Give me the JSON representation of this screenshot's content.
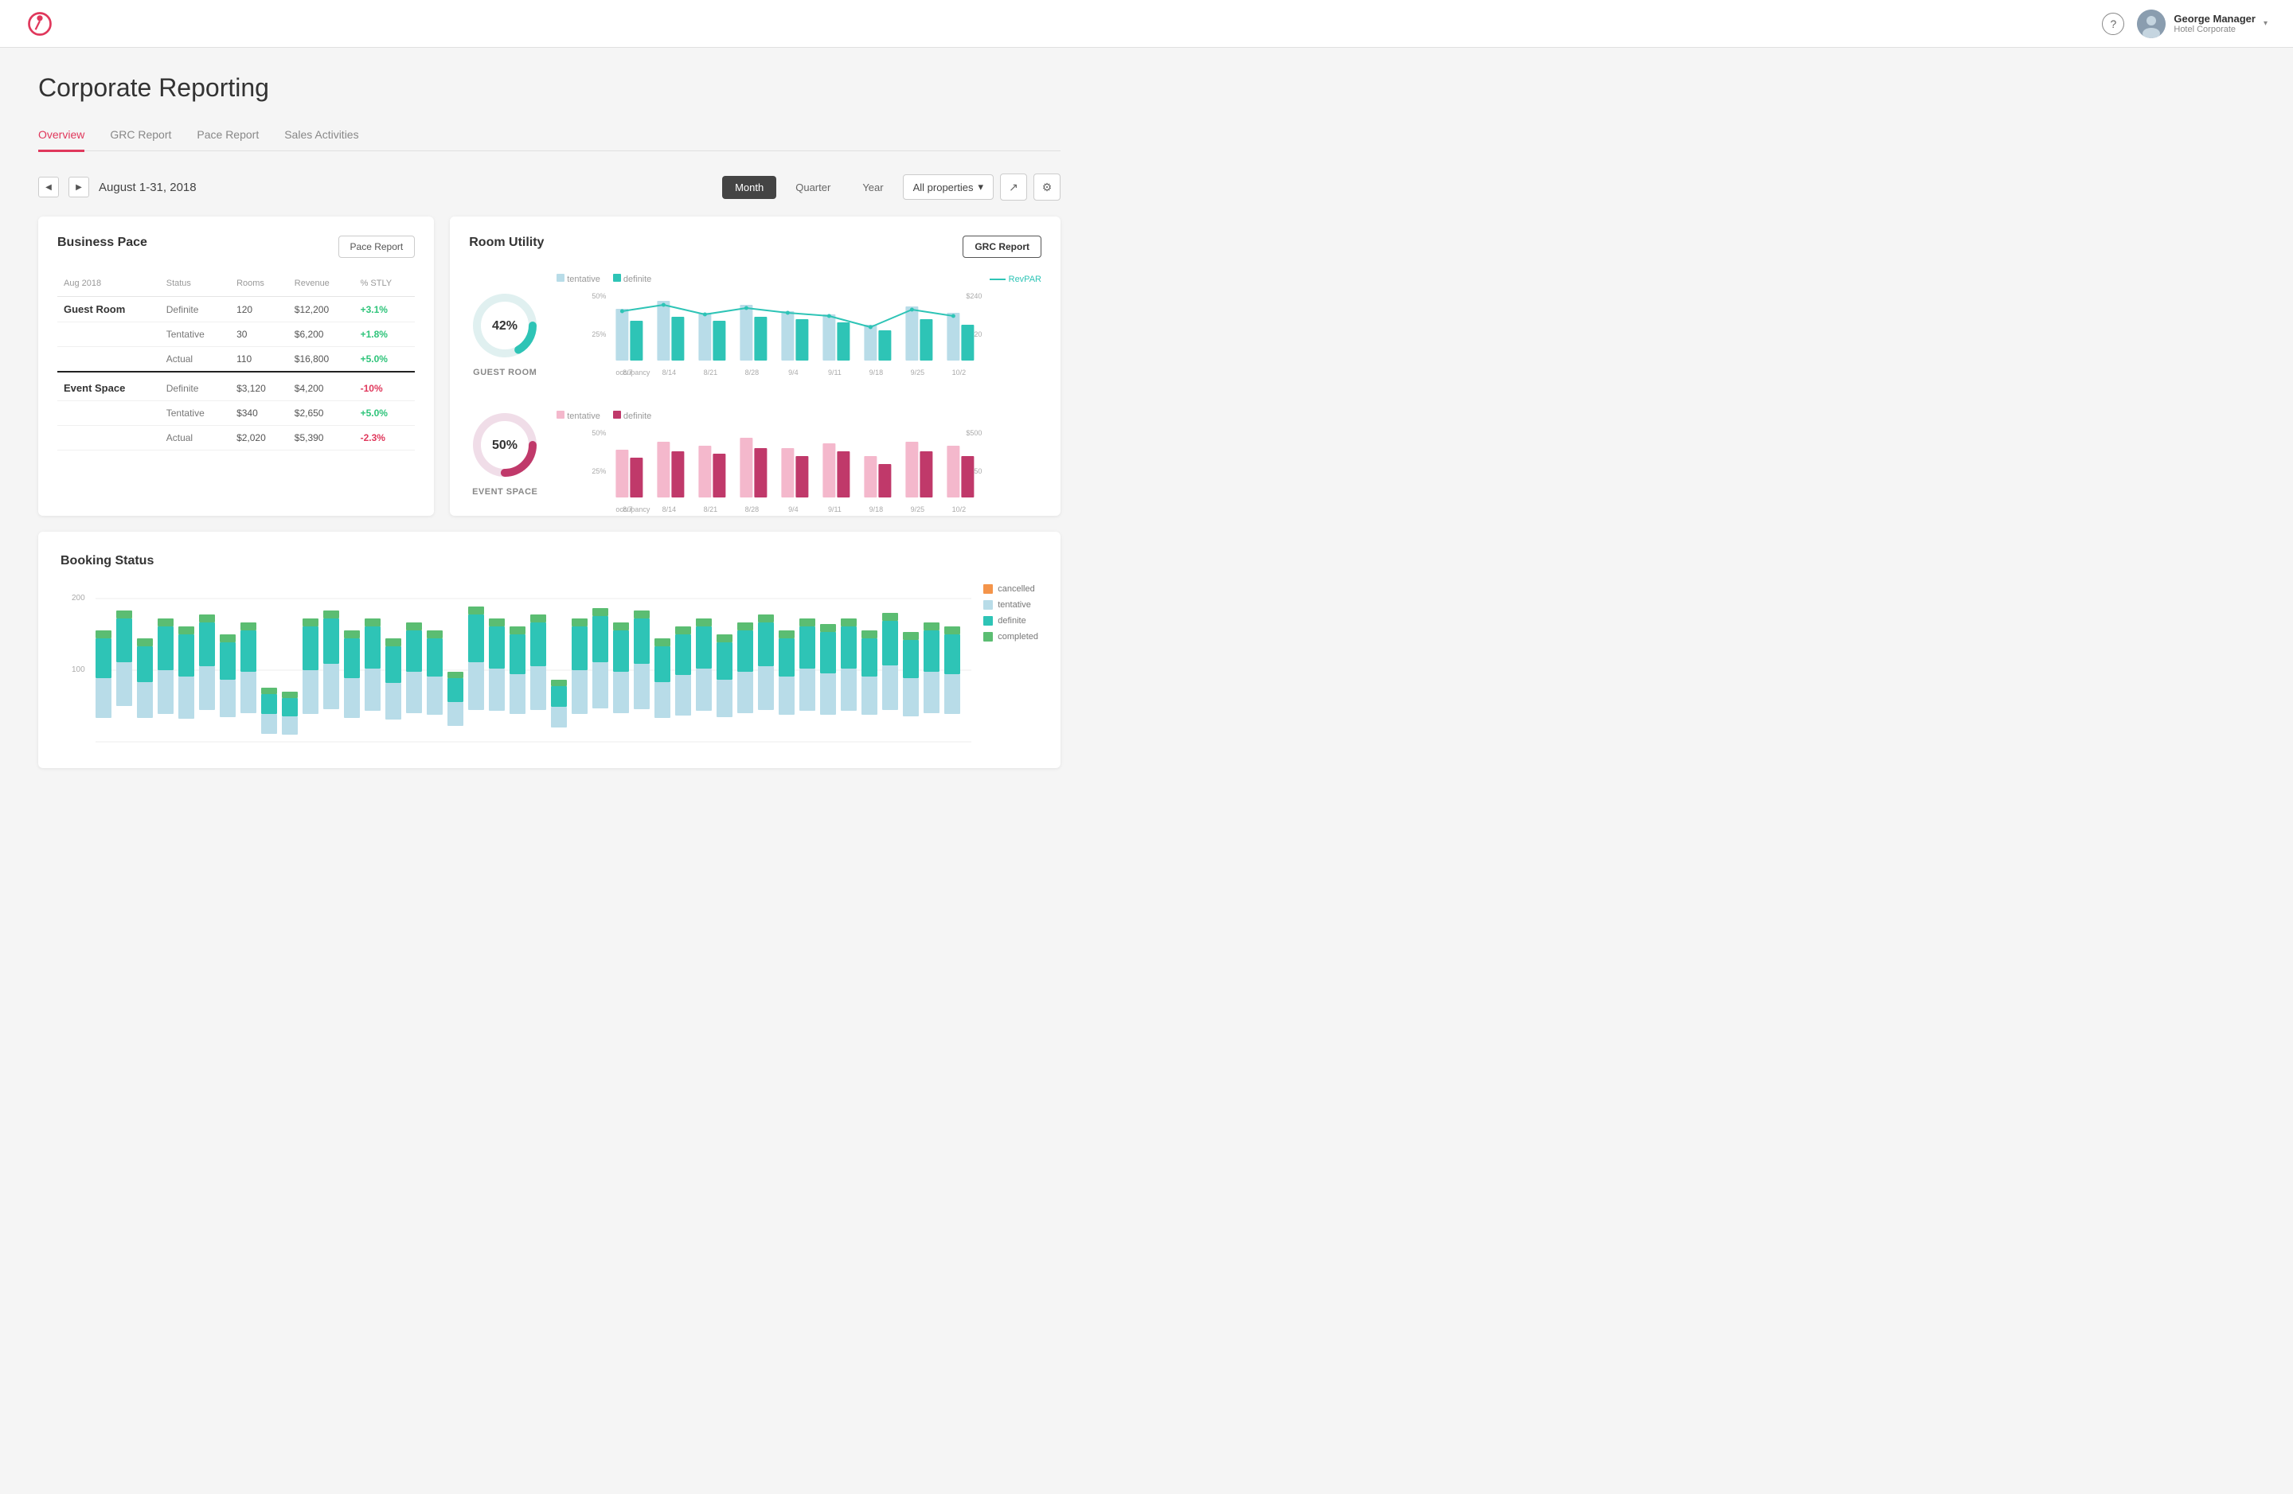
{
  "header": {
    "help_label": "?",
    "user": {
      "name": "George Manager",
      "role": "Hotel Corporate",
      "dropdown_arrow": "▾"
    }
  },
  "page": {
    "title": "Corporate Reporting"
  },
  "tabs": [
    {
      "id": "overview",
      "label": "Overview",
      "active": true
    },
    {
      "id": "grc",
      "label": "GRC Report",
      "active": false
    },
    {
      "id": "pace",
      "label": "Pace Report",
      "active": false
    },
    {
      "id": "sales",
      "label": "Sales Activities",
      "active": false
    }
  ],
  "controls": {
    "date_label": "August 1-31, 2018",
    "period_buttons": [
      {
        "id": "month",
        "label": "Month",
        "active": true
      },
      {
        "id": "quarter",
        "label": "Quarter",
        "active": false
      },
      {
        "id": "year",
        "label": "Year",
        "active": false
      }
    ],
    "property_select_label": "All properties",
    "share_icon": "↗",
    "settings_icon": "⚙"
  },
  "business_pace": {
    "title": "Business Pace",
    "action_label": "Pace Report",
    "table": {
      "headers": [
        "Aug 2018",
        "Status",
        "Rooms",
        "Revenue",
        "% STLY"
      ],
      "sections": [
        {
          "name": "Guest Room",
          "rows": [
            {
              "type": "Definite",
              "rooms": "120",
              "revenue": "$12,200",
              "stly": "+3.1%",
              "stly_type": "positive"
            },
            {
              "type": "Tentative",
              "rooms": "30",
              "revenue": "$6,200",
              "stly": "+1.8%",
              "stly_type": "positive"
            },
            {
              "type": "Actual",
              "rooms": "110",
              "revenue": "$16,800",
              "stly": "+5.0%",
              "stly_type": "positive"
            }
          ]
        },
        {
          "name": "Event Space",
          "rows": [
            {
              "type": "Definite",
              "rooms": "$3,120",
              "revenue": "$4,200",
              "stly": "-10%",
              "stly_type": "negative"
            },
            {
              "type": "Tentative",
              "rooms": "$340",
              "revenue": "$2,650",
              "stly": "+5.0%",
              "stly_type": "positive"
            },
            {
              "type": "Actual",
              "rooms": "$2,020",
              "revenue": "$5,390",
              "stly": "-2.3%",
              "stly_type": "negative"
            }
          ]
        }
      ]
    }
  },
  "room_utility": {
    "title": "Room Utility",
    "action_label": "GRC Report",
    "guest_room": {
      "percent": 42,
      "label": "GUEST ROOM"
    },
    "event_space": {
      "percent": 50,
      "label": "EVENT SPACE"
    },
    "chart_labels": {
      "tentative": "tentative",
      "definite": "definite",
      "revpar": "RevPAR",
      "occupancy": "occupancy",
      "x_labels": [
        "8/7",
        "8/14",
        "8/21",
        "8/28",
        "9/4",
        "9/11",
        "9/18",
        "9/25",
        "10/2"
      ],
      "guest_y_left": [
        "50%",
        "25%"
      ],
      "guest_y_right": [
        "$240",
        "$120"
      ],
      "event_y_left": [
        "50%",
        "25%"
      ],
      "event_y_right": [
        "$500",
        "$250"
      ]
    }
  },
  "booking_status": {
    "title": "Booking Status",
    "y_labels": [
      "200",
      "100"
    ],
    "legend": [
      {
        "label": "cancelled",
        "color": "#f4944a"
      },
      {
        "label": "tentative",
        "color": "#b8dce8"
      },
      {
        "label": "definite",
        "color": "#2ec4b6"
      },
      {
        "label": "completed",
        "color": "#5bbd72"
      }
    ]
  }
}
